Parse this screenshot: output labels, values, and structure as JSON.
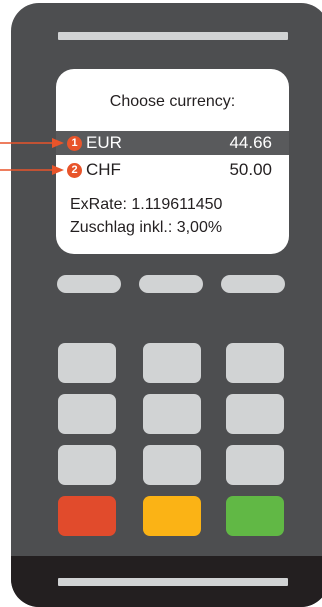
{
  "screen": {
    "title": "Choose currency:",
    "options": [
      {
        "number": "1",
        "code": "EUR",
        "amount": "44.66",
        "selected": true
      },
      {
        "number": "2",
        "code": "CHF",
        "amount": "50.00",
        "selected": false
      }
    ],
    "exrate": "ExRate: 1.119611450",
    "surcharge": "Zuschlag inkl.: 3,00%"
  },
  "colors": {
    "terminal": "#4d4e50",
    "accent": "#e8542a",
    "cancel": "#e14b2c",
    "clear": "#fbb315",
    "confirm": "#61b845"
  },
  "keypad": {
    "function_keys": [
      "cancel-key",
      "clear-key",
      "confirm-key"
    ]
  }
}
